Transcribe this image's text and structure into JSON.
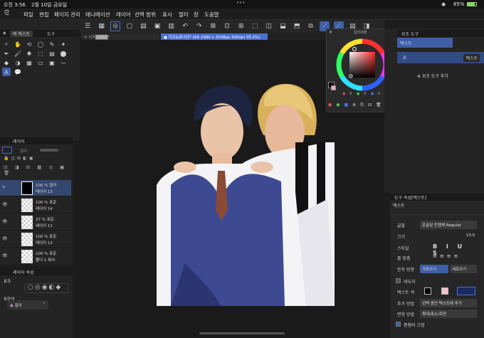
{
  "status": {
    "time": "오전 3:56",
    "date": "2월 10일 금요일",
    "battery": "85%",
    "dots": "•••"
  },
  "menu": [
    "파일",
    "편집",
    "페이지 관리",
    "애니메이션",
    "레이어",
    "선택 범위",
    "표시",
    "필터",
    "창",
    "도움말"
  ],
  "tool_panel": {
    "tabs": [
      "보조 도구",
      "도구"
    ],
    "sub_tab": "텍 텍스트"
  },
  "canvas_tabs": [
    {
      "label": "시저████*",
      "active": false
    },
    {
      "label": "디오&죠나단* (A4 2480 x 3508px 300dpi 35.2%)",
      "active": true
    }
  ],
  "color_panel": {
    "title": "컬러써클",
    "values": [
      "0",
      "0",
      "0"
    ]
  },
  "sub_tool_panel": {
    "title": "보조 도구",
    "header_label": "텍스트",
    "item_label": "텍스트",
    "add_label": "보조 도구 추가"
  },
  "layer_panel": {
    "title": "레이어",
    "blend_mode": "컬러",
    "layers": [
      {
        "opacity": "100 %  컬러",
        "name": "레이어 13"
      },
      {
        "opacity": "100 %  표준",
        "name": "레이어 14"
      },
      {
        "opacity": "27 %  표준",
        "name": "레이어 11"
      },
      {
        "opacity": "100 %  표준",
        "name": "레이어 12"
      },
      {
        "opacity": "100 %  표준",
        "name": "폴더 1 복사"
      }
    ]
  },
  "layer_property": {
    "title": "레이어 속성",
    "effect_label": "효과",
    "expression_label": "표현색",
    "expression_value": "컬러"
  },
  "tool_property": {
    "title": "도구 속성[텍스트]",
    "tool_name": "텍스트",
    "rows": {
      "font": {
        "label": "글꼴",
        "value": "온글잎 만렙체 Regular"
      },
      "size": {
        "label": "크기",
        "value": "13.0"
      },
      "style": {
        "label": "스타일",
        "value": "B I U S"
      },
      "align": {
        "label": "줄 맞춤"
      },
      "direction": {
        "label": "문자 방향",
        "horizontal": "가로쓰기",
        "vertical": "세로쓰기"
      },
      "border": {
        "label": "테두리"
      },
      "text_color": {
        "label": "텍스트 색"
      },
      "add_method": {
        "label": "추가 방법",
        "value": "선택 중인 텍스트에 추가"
      },
      "transform": {
        "label": "변형 방법",
        "value": "확대/축소/회전"
      },
      "keep_ratio": {
        "label": "종횡비 고정"
      }
    }
  },
  "colors": {
    "accent": "#4a6fd0",
    "bg": "#1c1c1c",
    "panel": "#242424"
  }
}
